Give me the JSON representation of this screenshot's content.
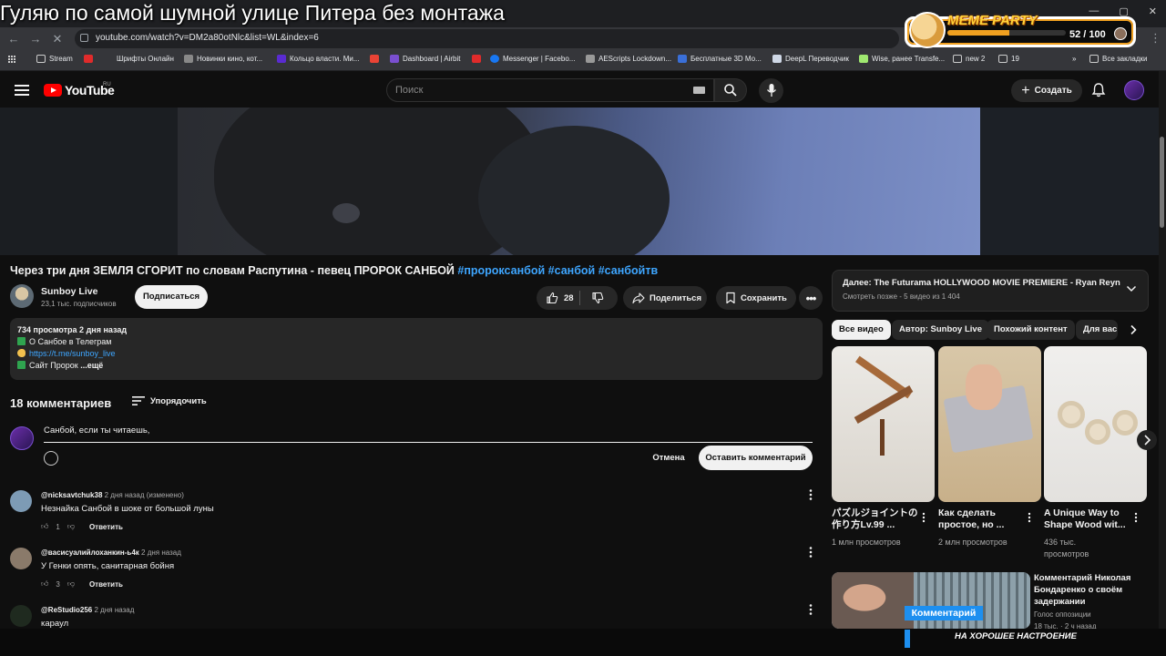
{
  "overlay": {
    "title": "Гуляю по самой шумной улице Питера без монтажа",
    "bottom_ticker": "НА ХОРОШЕЕ НАСТРОЕНИЕ"
  },
  "browser": {
    "url": "youtube.com/watch?v=DM2a80otNlc&list=WL&index=6",
    "bookmarks": [
      {
        "label": "Stream",
        "icon": "folder-icon"
      },
      {
        "label": "Шрифты Онлайн",
        "icon": "site-icon"
      },
      {
        "label": "Новинки кино, кот...",
        "icon": "site-icon"
      },
      {
        "label": "Кольцо власти. Ми...",
        "icon": "site-icon"
      },
      {
        "label": "Dashboard | Airbit",
        "icon": "site-icon"
      },
      {
        "label": "Messenger | Facebo...",
        "icon": "site-icon"
      },
      {
        "label": "AEScripts Lockdown...",
        "icon": "site-icon"
      },
      {
        "label": "Бесплатные 3D Мо...",
        "icon": "site-icon"
      },
      {
        "label": "DeepL Переводчик",
        "icon": "site-icon"
      },
      {
        "label": "Wise, ранее Transfe...",
        "icon": "site-icon"
      },
      {
        "label": "new 2",
        "icon": "folder-icon"
      },
      {
        "label": "19",
        "icon": "folder-icon"
      }
    ],
    "all_bookmarks": "Все закладки"
  },
  "meme_widget": {
    "logo": "MEME PARTY",
    "score": "52 / 100",
    "progress": 0.52
  },
  "header": {
    "logo": "YouTube",
    "region": "RU",
    "search_placeholder": "Поиск",
    "create_label": "Создать"
  },
  "video": {
    "title_main": "Через три дня ЗЕМЛЯ СГОРИТ по словам Распутина - певец ПРОРОК САНБОЙ ",
    "title_tags": "#пророксанбой #санбой #санбойтв",
    "channel": "Sunboy Live",
    "subs": "23,1 тыс. подписчиков",
    "subscribe": "Подписаться",
    "likes": "28",
    "share": "Поделиться",
    "save": "Сохранить"
  },
  "description": {
    "meta": "734 просмотра  2 дня назад",
    "line1": "О Санбое в Телеграм",
    "line2_link": "https://t.me/sunboy_live",
    "line3": "Сайт Пророк",
    "more": "...ещё"
  },
  "comments": {
    "count": "18 комментариев",
    "sort": "Упорядочить",
    "input_value": "Санбой, если ты читаешь,",
    "cancel": "Отмена",
    "submit": "Оставить комментарий",
    "reply_label": "Ответить",
    "items": [
      {
        "author": "@nicksavtchuk38",
        "time": "2 дня назад (изменено)",
        "text": "Незнайка Санбой в шоке от большой луны",
        "likes": "1",
        "avatar_color": "#7d9bb5"
      },
      {
        "author": "@васисуалийлоханкин-ь4к",
        "time": "2 дня назад",
        "text": "У Генки опять, санитарная бойня",
        "likes": "3",
        "avatar_color": "#8a7a6a"
      },
      {
        "author": "@ReStudio256",
        "time": "2 дня назад",
        "text": "караул",
        "likes": "",
        "avatar_color": "#1f2a1f"
      }
    ]
  },
  "sidebar": {
    "next_label": "Далее:",
    "next_title": "The Futurama HOLLYWOOD MOVIE PREMIERE - Ryan Reynolds...",
    "next_sub": "Смотреть позже - 5 видео из 1 404",
    "chips": [
      "Все видео",
      "Автор: Sunboy Live",
      "Похожий контент",
      "Для вас"
    ],
    "shorts": [
      {
        "title": "パズルジョイントの作り方Lv.99 ...",
        "views": "1 млн просмотров"
      },
      {
        "title": "Как сделать простое, но ...",
        "views": "2 млн просмотров"
      },
      {
        "title": "A Unique Way to Shape Wood wit...",
        "views": "436 тыс. просмотров"
      }
    ],
    "rec": {
      "badge": "Комментарий",
      "title": "Комментарий Николая Бондаренко о своём задержании",
      "channel": "Голос оппозиции",
      "views": "18 тыс. · 2 ч назад"
    }
  }
}
